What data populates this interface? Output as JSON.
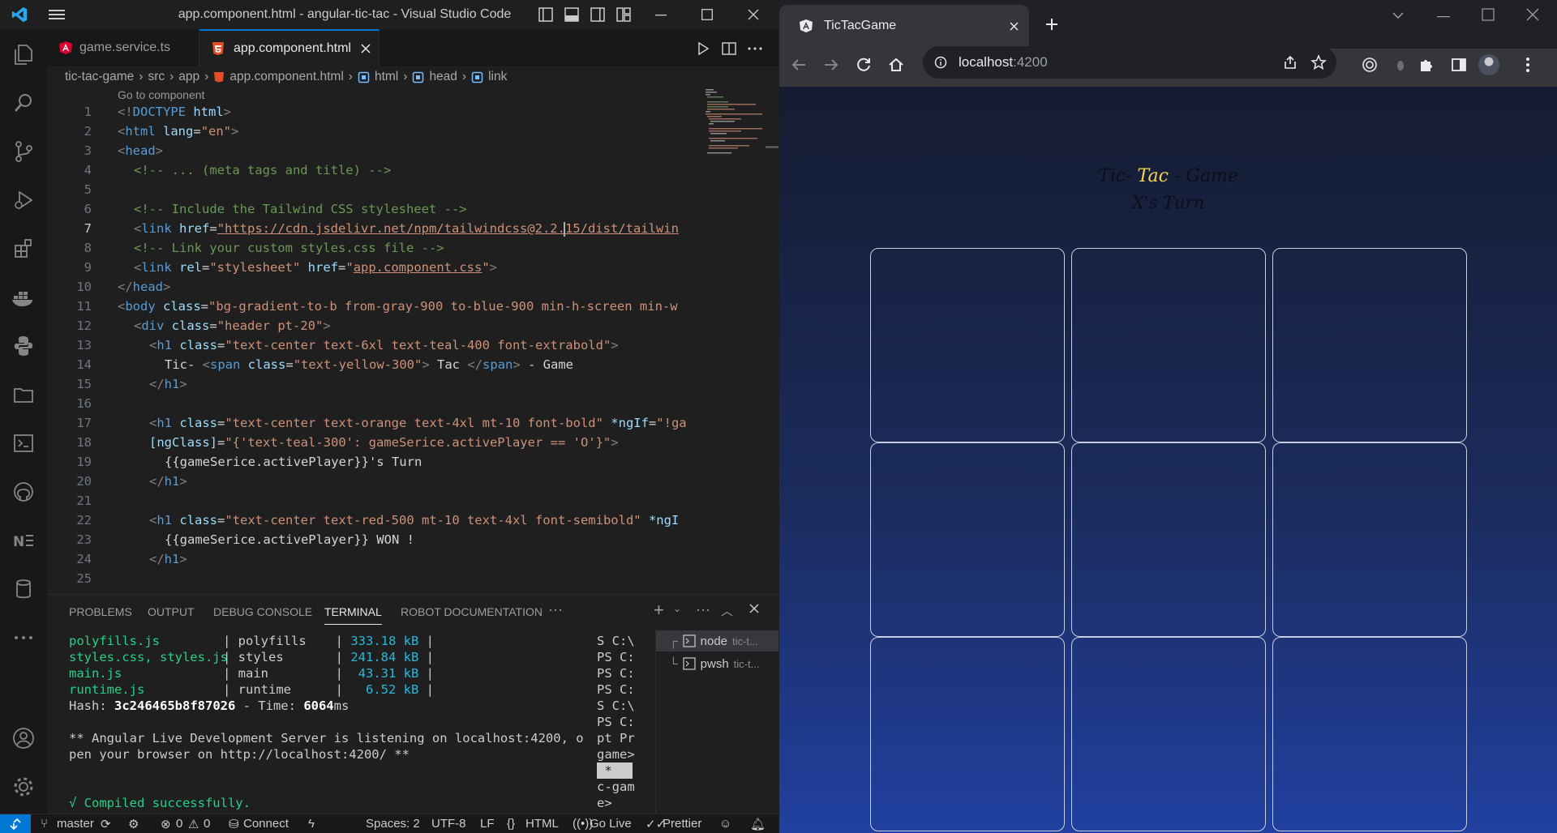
{
  "vscode": {
    "window_title": "app.component.html - angular-tic-tac - Visual Studio Code",
    "tabs": [
      {
        "label": "game.service.ts",
        "icon": "angular-icon",
        "active": false
      },
      {
        "label": "app.component.html",
        "icon": "html5-icon",
        "active": true
      }
    ],
    "breadcrumb": [
      "tic-tac-game",
      "src",
      "app",
      "app.component.html",
      "html",
      "head",
      "link"
    ],
    "codelens": "Go to component",
    "line_numbers": [
      "1",
      "2",
      "3",
      "4",
      "5",
      "6",
      "7",
      "8",
      "9",
      "10",
      "11",
      "12",
      "13",
      "14",
      "15",
      "16",
      "17",
      "18",
      "19",
      "20",
      "21",
      "22",
      "23",
      "24",
      "25"
    ],
    "code": {
      "l1": [
        "<!",
        "DOCTYPE",
        " html",
        ">"
      ],
      "l2": [
        "<",
        "html",
        " lang",
        "=",
        "\"en\"",
        ">"
      ],
      "l3": [
        "<",
        "head",
        ">"
      ],
      "l4": "<!-- ... (meta tags and title) -->",
      "l6": "<!-- Include the Tailwind CSS stylesheet -->",
      "l7": [
        "<",
        "link",
        " href",
        "=",
        "\"https://cdn.jsdelivr.net/npm/tailwindcss@2.2.15/dist/tailwin"
      ],
      "l8": "<!-- Link your custom styles.css file -->",
      "l9": [
        "<",
        "link",
        " rel",
        "=",
        "\"stylesheet\"",
        " href",
        "=",
        "\"",
        "app.component.css",
        "\"",
        ">"
      ],
      "l10": [
        "</",
        "head",
        ">"
      ],
      "l11": [
        "<",
        "body",
        " class",
        "=",
        "\"bg-gradient-to-b from-gray-900 to-blue-900 min-h-screen min-w"
      ],
      "l12": [
        "<",
        "div",
        " class",
        "=",
        "\"header pt-20\"",
        ">"
      ],
      "l13": [
        "<",
        "h1",
        " class",
        "=",
        "\"text-center text-6xl text-teal-400 font-extrabold\"",
        ">"
      ],
      "l14": [
        "Tic- ",
        "<",
        "span",
        " class",
        "=",
        "\"text-yellow-300\"",
        ">",
        " Tac ",
        "</",
        "span",
        ">",
        " - Game"
      ],
      "l15": [
        "</",
        "h1",
        ">"
      ],
      "l17": [
        "<",
        "h1",
        " class",
        "=",
        "\"text-center text-orange text-4xl mt-10 font-bold\"",
        " *ngIf",
        "=",
        "\"!ga"
      ],
      "l18": [
        "[ngClass]",
        "=",
        "\"{'text-teal-300': gameSerice.activePlayer == 'O'}\"",
        ">"
      ],
      "l19": "{{gameSerice.activePlayer}}'s Turn",
      "l20": [
        "</",
        "h1",
        ">"
      ],
      "l22": [
        "<",
        "h1",
        " class",
        "=",
        "\"text-center text-red-500 mt-10 text-4xl font-semibold\"",
        " *ngI"
      ],
      "l23": "{{gameSerice.activePlayer}} WON !",
      "l24": [
        "</",
        "h1",
        ">"
      ]
    },
    "panel_tabs": [
      "PROBLEMS",
      "OUTPUT",
      "DEBUG CONSOLE",
      "TERMINAL",
      "ROBOT DOCUMENTATION"
    ],
    "terminal": {
      "rows": [
        {
          "file": "polyfills.js",
          "name": "polyfills",
          "size": "333.18 kB"
        },
        {
          "file": "styles.css, styles.js",
          "name": "styles",
          "size": "241.84 kB"
        },
        {
          "file": "main.js",
          "name": "main",
          "size": " 43.31 kB"
        },
        {
          "file": "runtime.js",
          "name": "runtime",
          "size": "  6.52 kB"
        }
      ],
      "hash_label": "Hash: ",
      "hash": "3c246465b8f87026",
      "time_label": " - Time: ",
      "time": "6064",
      "time_unit": "ms",
      "server_line1": "** Angular Live Development Server is listening on localhost:4200, o",
      "server_line2": "pen your browser on http://localhost:4200/ **",
      "compiled": "√ Compiled successfully."
    },
    "terminal_side": [
      "S C:\\",
      "PS C:",
      "PS C:",
      "PS C:",
      "S C:\\",
      "PS C:",
      "pt Pr",
      "game>",
      " * ",
      "c-gam",
      "e>"
    ],
    "terminal_list": [
      {
        "name": "node",
        "detail": "tic-t..."
      },
      {
        "name": "pwsh",
        "detail": "tic-t..."
      }
    ],
    "status": {
      "branch": "master",
      "errors": "0",
      "warnings": "0",
      "connect": "Connect",
      "spaces": "Spaces: 2",
      "encoding": "UTF-8",
      "eol": "LF",
      "language": "HTML",
      "golive": "Go Live",
      "prettier": "Prettier"
    }
  },
  "chrome": {
    "tab_title": "TicTacGame",
    "url_host": "localhost",
    "url_port": ":4200",
    "page": {
      "title_prefix": "Tic- ",
      "title_highlight": "Tac",
      "title_suffix": " - Game",
      "turn": "X's Turn",
      "cells": [
        "",
        "",
        "",
        "",
        "",
        "",
        "",
        "",
        ""
      ]
    }
  },
  "colors": {
    "vscode_accent": "#0078d4",
    "tac_yellow": "#fcd34d",
    "page_gradient_top": "#151c31",
    "page_gradient_bottom": "#2140a0"
  }
}
